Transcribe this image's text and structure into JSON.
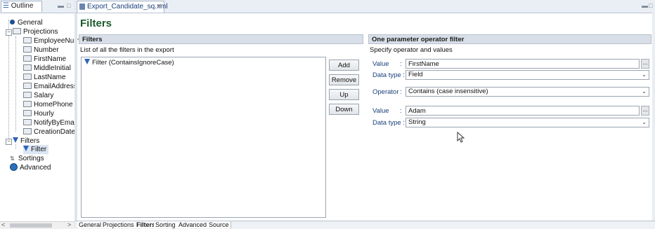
{
  "outline": {
    "tab_label": "Outline",
    "items": [
      {
        "label": "General"
      },
      {
        "label": "Projections"
      },
      {
        "label": "EmployeeNum"
      },
      {
        "label": "Number"
      },
      {
        "label": "FirstName"
      },
      {
        "label": "MiddleInitial"
      },
      {
        "label": "LastName"
      },
      {
        "label": "EmailAddress"
      },
      {
        "label": "Salary"
      },
      {
        "label": "HomePhone"
      },
      {
        "label": "Hourly"
      },
      {
        "label": "NotifyByEmail"
      },
      {
        "label": "CreationDate"
      },
      {
        "label": "Filters"
      },
      {
        "label": "Filter"
      },
      {
        "label": "Sortings"
      },
      {
        "label": "Advanced"
      }
    ]
  },
  "editor": {
    "tab_label": "Export_Candidate_sq.xml",
    "page_title": "Filters",
    "filters_section": {
      "header": "Filters",
      "description": "List of all the filters in the export",
      "list_items": [
        "Filter (ContainsIgnoreCase)"
      ],
      "buttons": {
        "add": "Add",
        "remove": "Remove",
        "up": "Up",
        "down": "Down"
      }
    },
    "operator_section": {
      "header": "One parameter operator filter",
      "description": "Specify operator and values",
      "value1_label": "Value",
      "value1": "FirstName",
      "datatype1_label": "Data type :",
      "datatype1": "Field",
      "operator_label": "Operator",
      "operator": "Contains (case insensitive)",
      "value2_label": "Value",
      "value2": "Adam",
      "datatype2_label": "Data type :",
      "datatype2": "String",
      "colon": ":",
      "ellipsis": "..."
    },
    "bottom_tabs": [
      "General",
      "Projections",
      "Filters",
      "Sorting",
      "Advanced",
      "Source"
    ]
  }
}
